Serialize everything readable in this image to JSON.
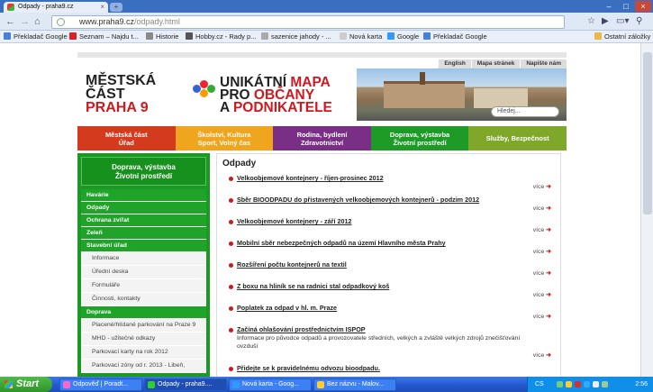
{
  "browser": {
    "tabs": [
      {
        "label": "Odpady - praha9.cz",
        "active": true
      }
    ],
    "new_tab": "+",
    "url_host": "www.praha9.cz",
    "url_path": "/odpady.html",
    "bookmarks": [
      {
        "label": "Překladač Google",
        "color": "#4a7fd8"
      },
      {
        "label": "Seznam – Najdu t...",
        "color": "#d22"
      },
      {
        "label": "Historie",
        "color": "#888"
      },
      {
        "label": "Hobby.cz - Rady p...",
        "color": "#555"
      },
      {
        "label": "sazenice jahody - ...",
        "color": "#aaa"
      },
      {
        "label": "Nová karta",
        "color": "#ccc"
      },
      {
        "label": "Google",
        "color": "#39f"
      },
      {
        "label": "Překladač Google",
        "color": "#4a7fd8"
      }
    ],
    "other_bookmarks": "Ostatní záložky"
  },
  "site": {
    "top_links": [
      "English",
      "Mapa stránek",
      "Napište nám"
    ],
    "logo": {
      "line1": "MĚSTSKÁ",
      "line2": "ČÁST",
      "line3": "PRAHA 9"
    },
    "tagline": {
      "w1": "UNIKÁTNÍ",
      "w2": "MAPA",
      "w3": "PRO",
      "w4": "OBČANY",
      "w5": "A",
      "w6": "PODNIKATELE"
    },
    "search_placeholder": "Hledej...",
    "nav": [
      {
        "line1": "Městská část",
        "line2": "Úřad",
        "color": "#d43a1e"
      },
      {
        "line1": "Školství, Kultura",
        "line2": "Sport, Volný čas",
        "color": "#f0a51e"
      },
      {
        "line1": "Rodina, bydlení",
        "line2": "Zdravotnictví",
        "color": "#7a2f86"
      },
      {
        "line1": "Doprava, výstavba",
        "line2": "Životní prostředí",
        "color": "#1e9a27"
      },
      {
        "line1": "Služby, Bezpečnost",
        "line2": "",
        "color": "#7fa82a"
      }
    ],
    "sidebar": {
      "head1": "Doprava, výstavba",
      "head2": "Životní prostředí",
      "items": [
        {
          "label": "Havárie",
          "type": "main"
        },
        {
          "label": "Odpady",
          "type": "main"
        },
        {
          "label": "Ochrana zvířat",
          "type": "main"
        },
        {
          "label": "Zeleň",
          "type": "main"
        },
        {
          "label": "Stavební úřad",
          "type": "main"
        },
        {
          "label": "Informace",
          "type": "sub"
        },
        {
          "label": "Úřední deska",
          "type": "sub"
        },
        {
          "label": "Formuláře",
          "type": "sub"
        },
        {
          "label": "Činnosti, kontakty",
          "type": "sub"
        },
        {
          "label": "Doprava",
          "type": "main"
        },
        {
          "label": "Placené/hlídané parkování na Praze 9",
          "type": "sub"
        },
        {
          "label": "MHD - užitečné odkazy",
          "type": "sub"
        },
        {
          "label": "Parkovací karty na rok 2012",
          "type": "sub"
        },
        {
          "label": "Parkovací zóny od r. 2013 - Libeň,",
          "type": "sub"
        }
      ]
    },
    "content": {
      "title": "Odpady",
      "more": "více",
      "articles": [
        {
          "title": "Velkoobjemové kontejnery - říjen-prosinec 2012",
          "desc": ""
        },
        {
          "title": "Sběr BIOODPADU do přistavených velkoobjemových kontejnerů - podzim 2012",
          "desc": ""
        },
        {
          "title": "Velkoobjemové kontejnery - září 2012",
          "desc": ""
        },
        {
          "title": "Mobilní sběr nebezpečných odpadů na území Hlavního města Prahy",
          "desc": ""
        },
        {
          "title": "Rozšíření počtu kontejnerů na textil",
          "desc": ""
        },
        {
          "title": "Z boxu na hliník se na radnici stal odpadkový koš",
          "desc": ""
        },
        {
          "title": "Poplatek za odpad v hl. m. Praze",
          "desc": ""
        },
        {
          "title": "Začíná ohlašování prostřednictvím ISPOP",
          "desc": "Informace pro původce odpadů a provozovatele středních, velkých a zvláště velkých zdrojů znečišťování ovzduší"
        },
        {
          "title": "Přidejte se k pravidelnému odvozu bioodpadu.",
          "desc": ""
        }
      ]
    }
  },
  "taskbar": {
    "start": "Start",
    "tasks": [
      {
        "label": "Odpověď | Poradt...",
        "color": "#f6c"
      },
      {
        "label": "Odpady - praha9....",
        "color": "#3c3",
        "active": true
      },
      {
        "label": "Nová karta - Goog...",
        "color": "#39f"
      },
      {
        "label": "Bez názvu - Malov...",
        "color": "#fc3"
      }
    ],
    "lang": "CS",
    "clock": "2:56"
  }
}
